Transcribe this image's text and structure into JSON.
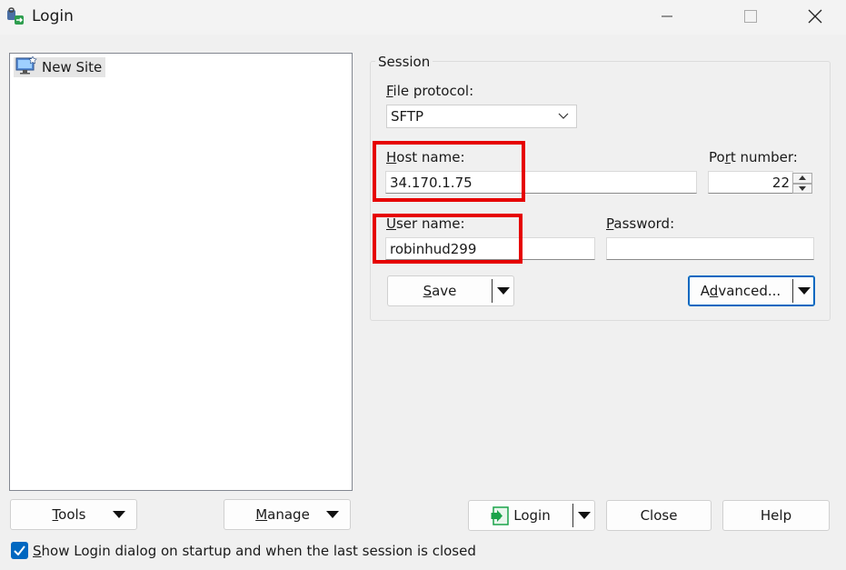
{
  "window": {
    "title": "Login",
    "icons": [
      "winscp-app-icon",
      "minimize-icon",
      "maximize-icon",
      "close-icon"
    ]
  },
  "site_tree": {
    "items": [
      {
        "label": "New Site",
        "icon": "new-site-monitor-icon",
        "selected": true
      }
    ]
  },
  "session": {
    "group_label": "Session",
    "file_protocol": {
      "label_hotkey": "F",
      "label_rest": "ile protocol:",
      "value": "SFTP"
    },
    "host_name": {
      "label_hotkey": "H",
      "label_rest": "ost name:",
      "value": "34.170.1.75"
    },
    "port_number": {
      "label_pre": "Po",
      "label_hotkey": "r",
      "label_rest": "t number:",
      "value": "22"
    },
    "user_name": {
      "label_hotkey": "U",
      "label_rest": "ser name:",
      "value": "robinhud299"
    },
    "password": {
      "label_hotkey": "P",
      "label_rest": "assword:",
      "value": ""
    },
    "save_button": {
      "label_hotkey": "S",
      "label_rest": "ave"
    },
    "advanced_button": {
      "label_pre": "A",
      "label_hotkey": "d",
      "label_rest": "vanced..."
    }
  },
  "bottom": {
    "tools": {
      "label_hotkey": "T",
      "label_rest": "ools"
    },
    "manage": {
      "label_hotkey": "M",
      "label_rest": "anage"
    },
    "login": {
      "label": "Login"
    },
    "close": {
      "label": "Close"
    },
    "help": {
      "label": "Help"
    },
    "show_login_checkbox": {
      "checked": true,
      "label_hotkey": "S",
      "label_rest": "how Login dialog on startup and when the last session is closed"
    }
  },
  "colors": {
    "accent": "#0067c0",
    "highlight_box": "#e60000",
    "login_icon": "#1aa34a"
  }
}
